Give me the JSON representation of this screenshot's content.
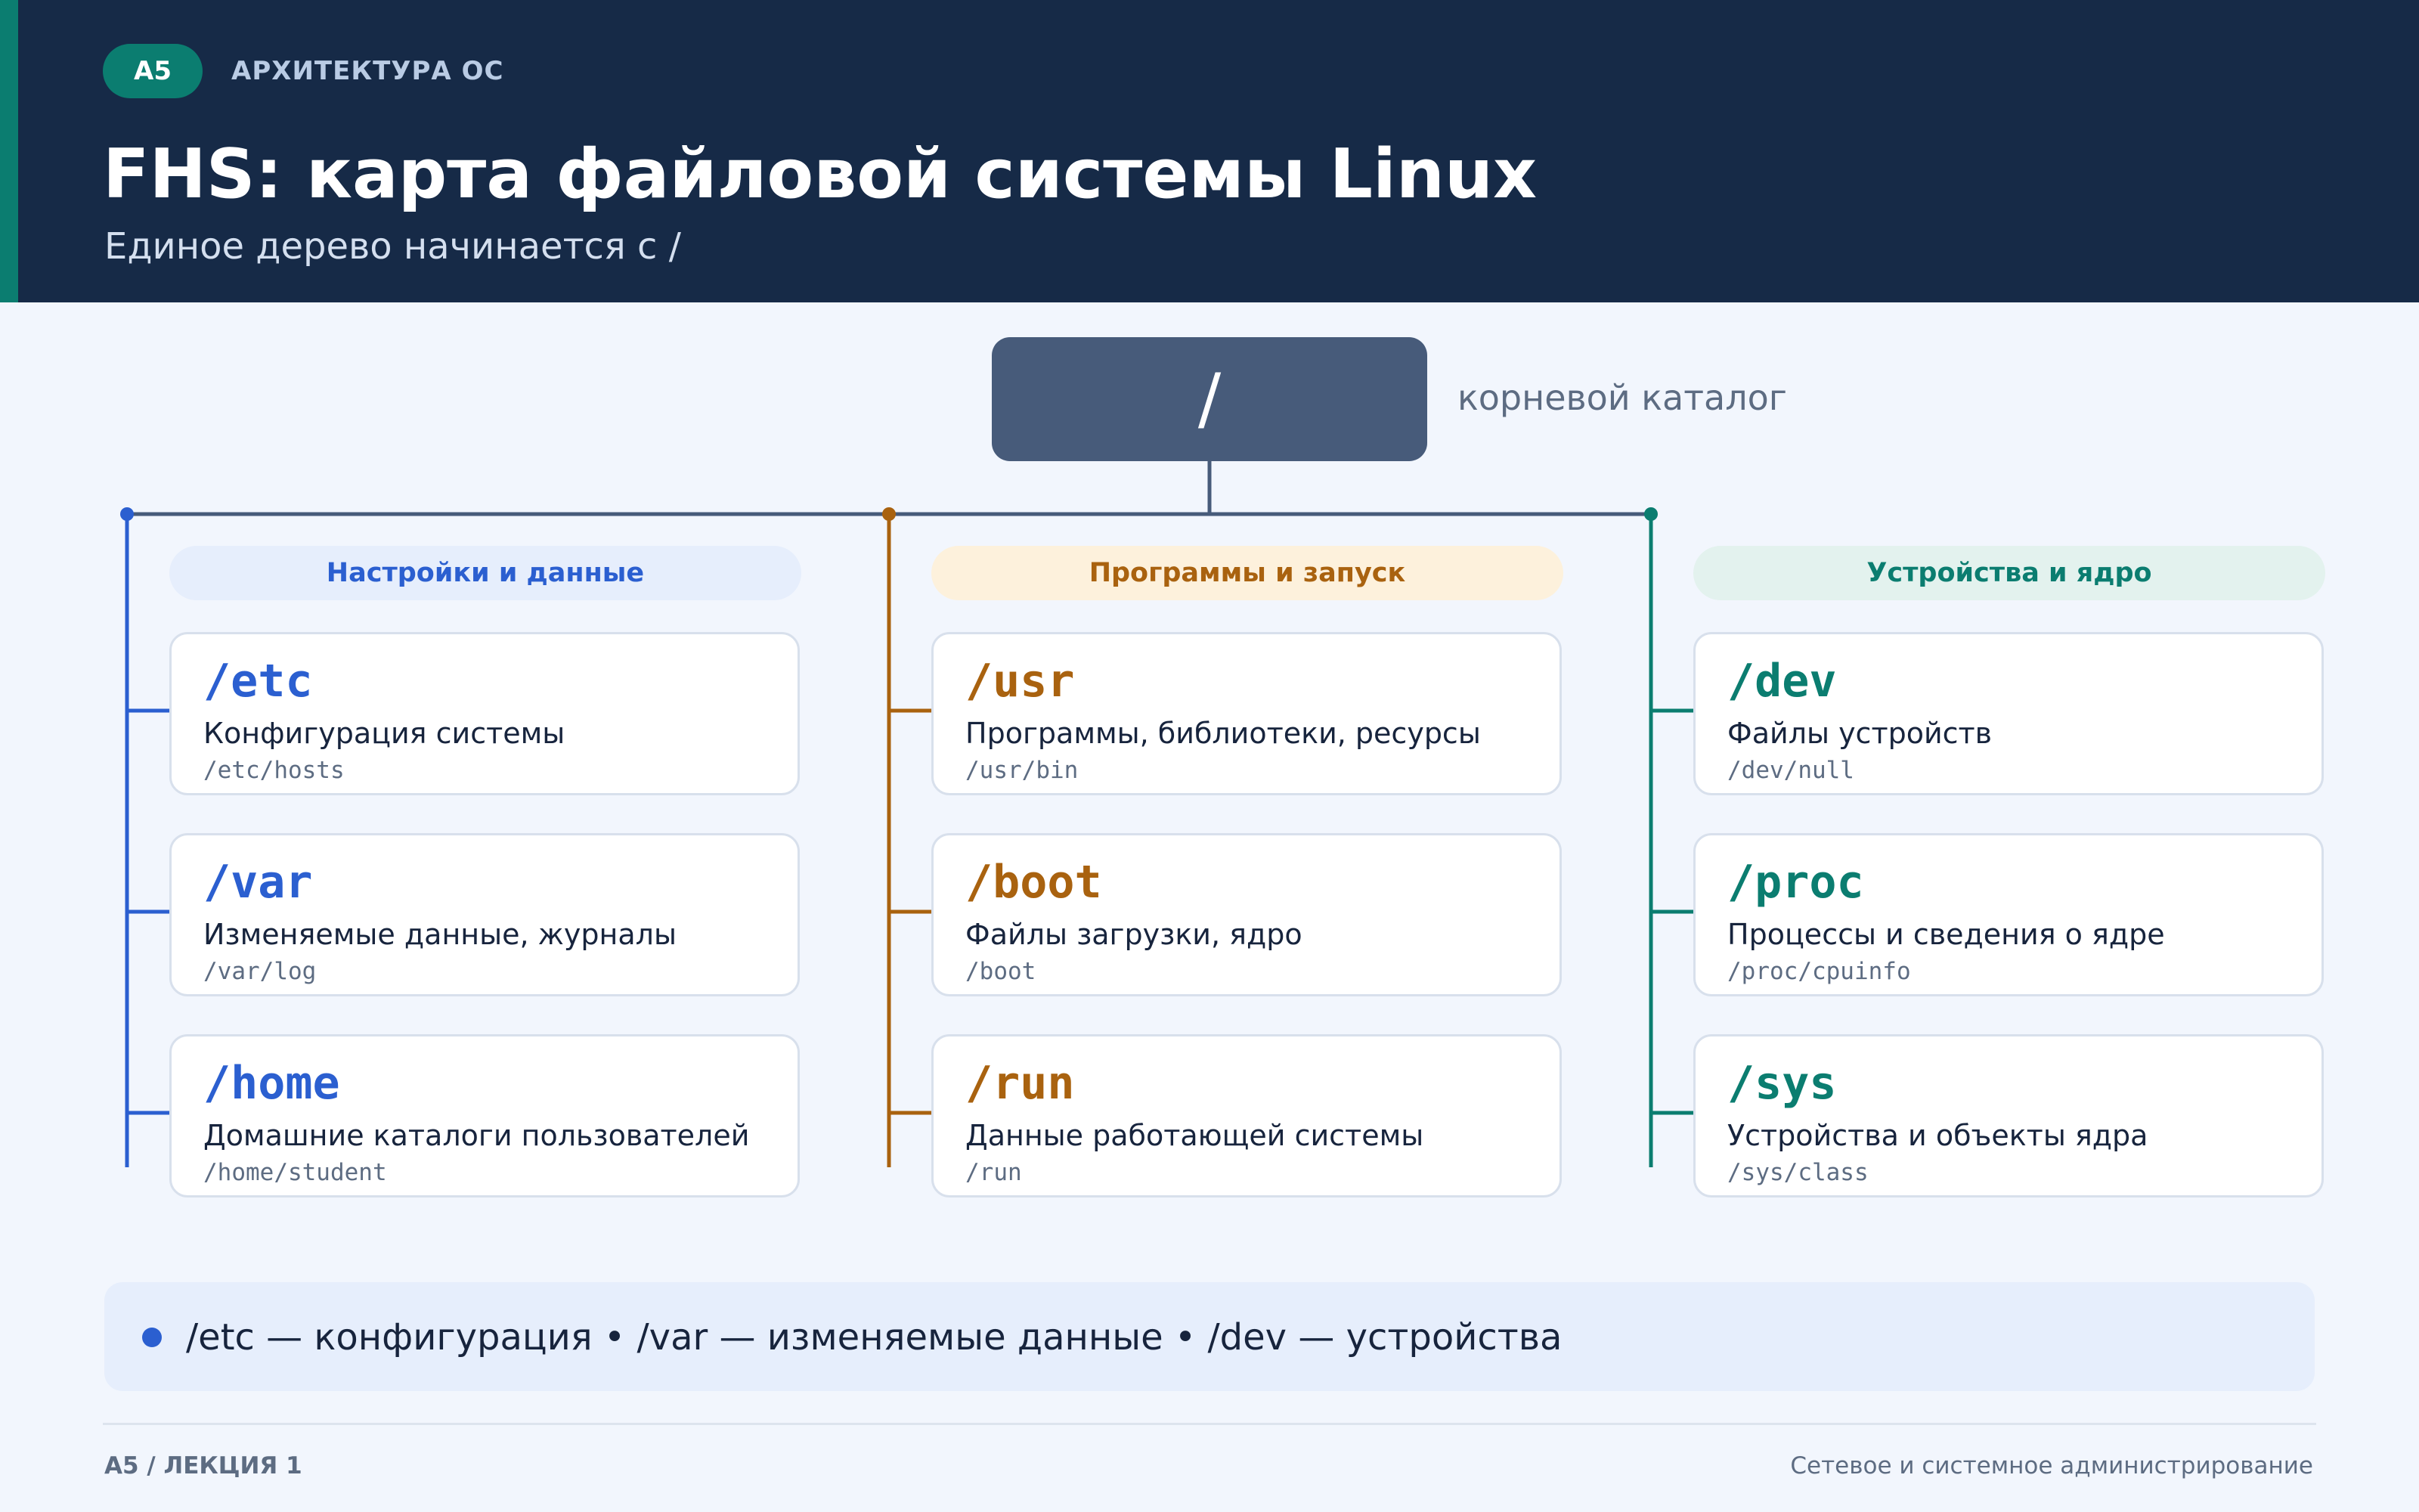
{
  "header": {
    "badge": "A5",
    "kicker": "АРХИТЕКТУРА ОС",
    "title": "FHS: карта файловой системы Linux",
    "subtitle": "Единое дерево начинается с /"
  },
  "root": {
    "label": "/",
    "caption": "корневой каталог"
  },
  "colors": {
    "header_bg": "#162a47",
    "accent_teal": "#0b7d70",
    "root_node": "#475b7a",
    "blue": "#2b5fd0",
    "orange": "#a9620f",
    "teal": "#0b7d70"
  },
  "categories": [
    {
      "name": "Настройки и данные",
      "color": "#2b5fd0",
      "pill_bg": "#e6eefc",
      "items": [
        {
          "path": "/etc",
          "desc": "Конфигурация системы",
          "example": "/etc/hosts"
        },
        {
          "path": "/var",
          "desc": "Изменяемые данные, журналы",
          "example": "/var/log"
        },
        {
          "path": "/home",
          "desc": "Домашние каталоги пользователей",
          "example": "/home/student"
        }
      ]
    },
    {
      "name": "Программы и запуск",
      "color": "#a9620f",
      "pill_bg": "#fdf1dc",
      "items": [
        {
          "path": "/usr",
          "desc": "Программы, библиотеки, ресурсы",
          "example": "/usr/bin"
        },
        {
          "path": "/boot",
          "desc": "Файлы загрузки, ядро",
          "example": "/boot"
        },
        {
          "path": "/run",
          "desc": "Данные работающей системы",
          "example": "/run"
        }
      ]
    },
    {
      "name": "Устройства и ядро",
      "color": "#0b7d70",
      "pill_bg": "#e3f2ee",
      "items": [
        {
          "path": "/dev",
          "desc": "Файлы устройств",
          "example": "/dev/null"
        },
        {
          "path": "/proc",
          "desc": "Процессы и сведения о ядре",
          "example": "/proc/cpuinfo"
        },
        {
          "path": "/sys",
          "desc": "Устройства и объекты ядра",
          "example": "/sys/class"
        }
      ]
    }
  ],
  "summary": {
    "text": "/etc — конфигурация • /var — изменяемые данные • /dev — устройства"
  },
  "footer": {
    "left": "A5 / ЛЕКЦИЯ 1",
    "right": "Сетевое и системное администрирование"
  }
}
